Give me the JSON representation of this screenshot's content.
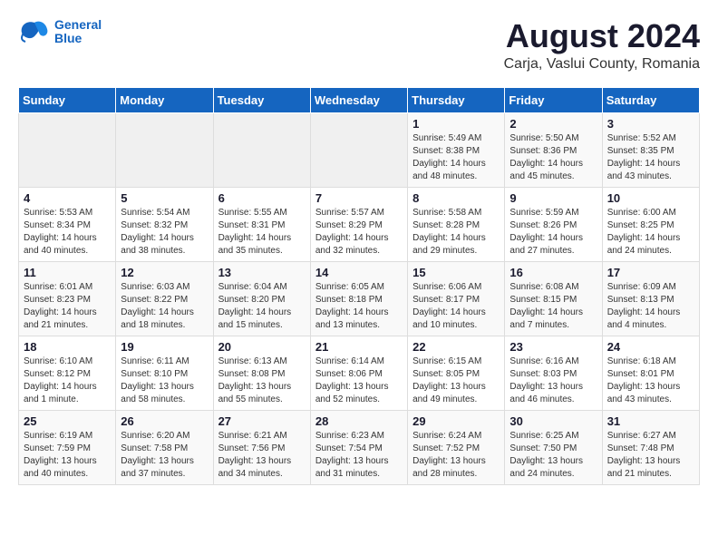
{
  "logo": {
    "line1": "General",
    "line2": "Blue"
  },
  "title": {
    "month_year": "August 2024",
    "location": "Carja, Vaslui County, Romania"
  },
  "headers": [
    "Sunday",
    "Monday",
    "Tuesday",
    "Wednesday",
    "Thursday",
    "Friday",
    "Saturday"
  ],
  "weeks": [
    [
      {
        "day": "",
        "info": ""
      },
      {
        "day": "",
        "info": ""
      },
      {
        "day": "",
        "info": ""
      },
      {
        "day": "",
        "info": ""
      },
      {
        "day": "1",
        "info": "Sunrise: 5:49 AM\nSunset: 8:38 PM\nDaylight: 14 hours\nand 48 minutes."
      },
      {
        "day": "2",
        "info": "Sunrise: 5:50 AM\nSunset: 8:36 PM\nDaylight: 14 hours\nand 45 minutes."
      },
      {
        "day": "3",
        "info": "Sunrise: 5:52 AM\nSunset: 8:35 PM\nDaylight: 14 hours\nand 43 minutes."
      }
    ],
    [
      {
        "day": "4",
        "info": "Sunrise: 5:53 AM\nSunset: 8:34 PM\nDaylight: 14 hours\nand 40 minutes."
      },
      {
        "day": "5",
        "info": "Sunrise: 5:54 AM\nSunset: 8:32 PM\nDaylight: 14 hours\nand 38 minutes."
      },
      {
        "day": "6",
        "info": "Sunrise: 5:55 AM\nSunset: 8:31 PM\nDaylight: 14 hours\nand 35 minutes."
      },
      {
        "day": "7",
        "info": "Sunrise: 5:57 AM\nSunset: 8:29 PM\nDaylight: 14 hours\nand 32 minutes."
      },
      {
        "day": "8",
        "info": "Sunrise: 5:58 AM\nSunset: 8:28 PM\nDaylight: 14 hours\nand 29 minutes."
      },
      {
        "day": "9",
        "info": "Sunrise: 5:59 AM\nSunset: 8:26 PM\nDaylight: 14 hours\nand 27 minutes."
      },
      {
        "day": "10",
        "info": "Sunrise: 6:00 AM\nSunset: 8:25 PM\nDaylight: 14 hours\nand 24 minutes."
      }
    ],
    [
      {
        "day": "11",
        "info": "Sunrise: 6:01 AM\nSunset: 8:23 PM\nDaylight: 14 hours\nand 21 minutes."
      },
      {
        "day": "12",
        "info": "Sunrise: 6:03 AM\nSunset: 8:22 PM\nDaylight: 14 hours\nand 18 minutes."
      },
      {
        "day": "13",
        "info": "Sunrise: 6:04 AM\nSunset: 8:20 PM\nDaylight: 14 hours\nand 15 minutes."
      },
      {
        "day": "14",
        "info": "Sunrise: 6:05 AM\nSunset: 8:18 PM\nDaylight: 14 hours\nand 13 minutes."
      },
      {
        "day": "15",
        "info": "Sunrise: 6:06 AM\nSunset: 8:17 PM\nDaylight: 14 hours\nand 10 minutes."
      },
      {
        "day": "16",
        "info": "Sunrise: 6:08 AM\nSunset: 8:15 PM\nDaylight: 14 hours\nand 7 minutes."
      },
      {
        "day": "17",
        "info": "Sunrise: 6:09 AM\nSunset: 8:13 PM\nDaylight: 14 hours\nand 4 minutes."
      }
    ],
    [
      {
        "day": "18",
        "info": "Sunrise: 6:10 AM\nSunset: 8:12 PM\nDaylight: 14 hours\nand 1 minute."
      },
      {
        "day": "19",
        "info": "Sunrise: 6:11 AM\nSunset: 8:10 PM\nDaylight: 13 hours\nand 58 minutes."
      },
      {
        "day": "20",
        "info": "Sunrise: 6:13 AM\nSunset: 8:08 PM\nDaylight: 13 hours\nand 55 minutes."
      },
      {
        "day": "21",
        "info": "Sunrise: 6:14 AM\nSunset: 8:06 PM\nDaylight: 13 hours\nand 52 minutes."
      },
      {
        "day": "22",
        "info": "Sunrise: 6:15 AM\nSunset: 8:05 PM\nDaylight: 13 hours\nand 49 minutes."
      },
      {
        "day": "23",
        "info": "Sunrise: 6:16 AM\nSunset: 8:03 PM\nDaylight: 13 hours\nand 46 minutes."
      },
      {
        "day": "24",
        "info": "Sunrise: 6:18 AM\nSunset: 8:01 PM\nDaylight: 13 hours\nand 43 minutes."
      }
    ],
    [
      {
        "day": "25",
        "info": "Sunrise: 6:19 AM\nSunset: 7:59 PM\nDaylight: 13 hours\nand 40 minutes."
      },
      {
        "day": "26",
        "info": "Sunrise: 6:20 AM\nSunset: 7:58 PM\nDaylight: 13 hours\nand 37 minutes."
      },
      {
        "day": "27",
        "info": "Sunrise: 6:21 AM\nSunset: 7:56 PM\nDaylight: 13 hours\nand 34 minutes."
      },
      {
        "day": "28",
        "info": "Sunrise: 6:23 AM\nSunset: 7:54 PM\nDaylight: 13 hours\nand 31 minutes."
      },
      {
        "day": "29",
        "info": "Sunrise: 6:24 AM\nSunset: 7:52 PM\nDaylight: 13 hours\nand 28 minutes."
      },
      {
        "day": "30",
        "info": "Sunrise: 6:25 AM\nSunset: 7:50 PM\nDaylight: 13 hours\nand 24 minutes."
      },
      {
        "day": "31",
        "info": "Sunrise: 6:27 AM\nSunset: 7:48 PM\nDaylight: 13 hours\nand 21 minutes."
      }
    ]
  ]
}
